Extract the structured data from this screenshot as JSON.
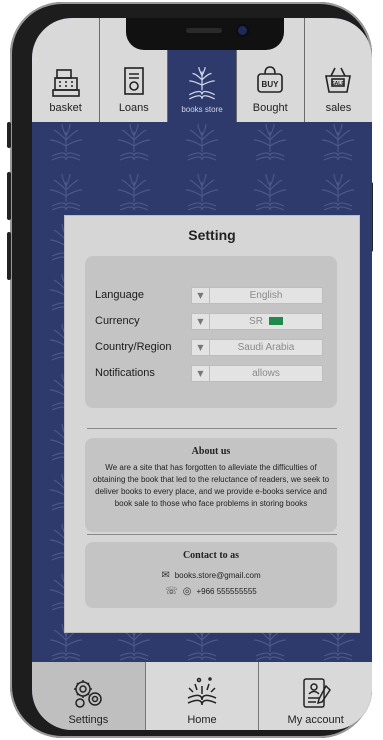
{
  "top_nav": {
    "items": [
      {
        "label": "basket",
        "icon": "cash-register-icon"
      },
      {
        "label": "Loans",
        "icon": "loan-receipt-icon"
      },
      {
        "label": "books store",
        "icon": "book-tree-logo-icon",
        "active": true
      },
      {
        "label": "Bought",
        "icon": "buy-bag-icon"
      },
      {
        "label": "sales",
        "icon": "sale-basket-icon"
      }
    ],
    "buy_badge": "BUY",
    "sale_badge": "SALE"
  },
  "settings": {
    "title": "Setting",
    "rows": [
      {
        "label": "Language",
        "value": "English"
      },
      {
        "label": "Currency",
        "value": "SR"
      },
      {
        "label": "Country/Region",
        "value": "Saudi Arabia"
      },
      {
        "label": "Notifications",
        "value": "allows"
      }
    ]
  },
  "about": {
    "heading": "About us",
    "text": "We are a site that has forgotten to alleviate the difficulties of obtaining the book that led to the reluctance of readers, we seek to deliver books to every place, and we provide e-books service and book sale to those who face problems in storing books"
  },
  "contact": {
    "heading": "Contact to as",
    "email": "books.store@gmail.com",
    "phone": "+966 555555555"
  },
  "bottom_nav": {
    "items": [
      {
        "label": "Settings",
        "icon": "gears-icon",
        "active": true
      },
      {
        "label": "Home",
        "icon": "open-book-icon"
      },
      {
        "label": "My account",
        "icon": "account-document-icon"
      }
    ]
  },
  "colors": {
    "background_navy": "#2d3a6b",
    "card": "#d6d6d6",
    "panel": "#c4c4c4",
    "nav": "#d9d9d9",
    "flag_green": "#1f8a4c"
  }
}
